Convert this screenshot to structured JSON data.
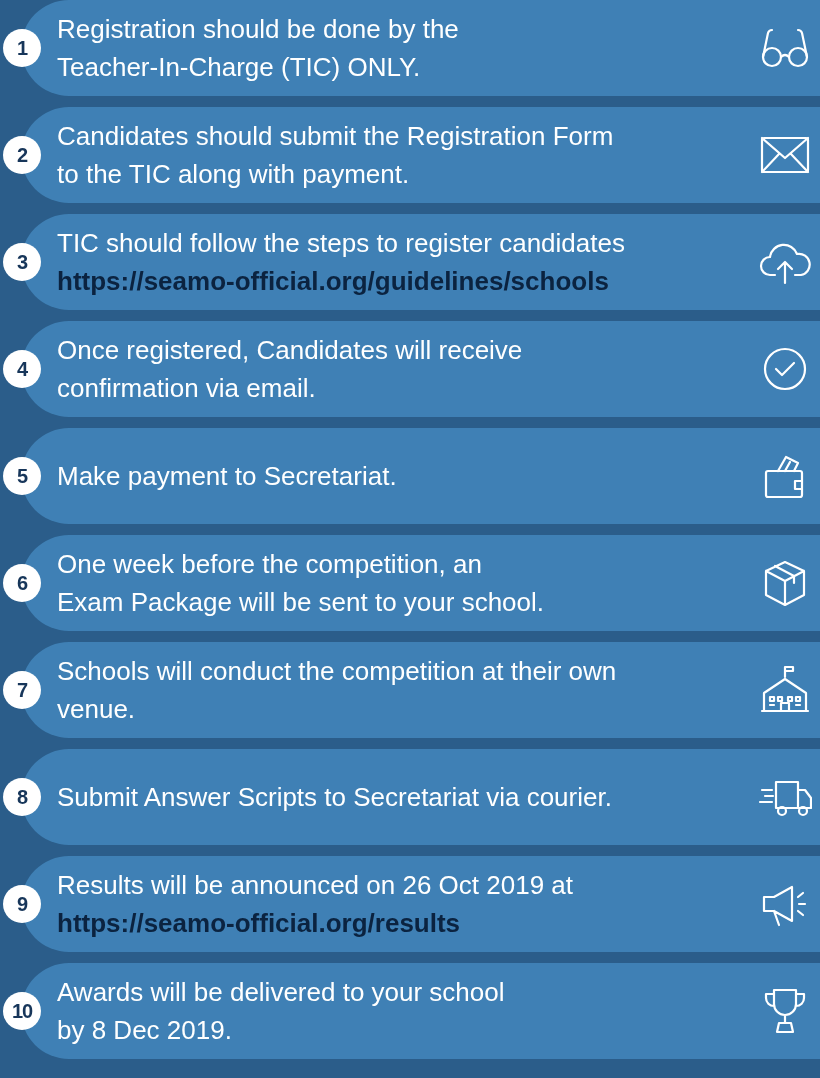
{
  "steps": [
    {
      "number": "1",
      "lines": [
        "Registration should be done by the",
        "Teacher-In-Charge (TIC) ONLY."
      ]
    },
    {
      "number": "2",
      "lines": [
        "Candidates should submit the Registration Form",
        "to the TIC along with payment."
      ]
    },
    {
      "number": "3",
      "lines": [
        "TIC should follow the steps to register candidates"
      ],
      "link": "https://seamo-official.org/guidelines/schools"
    },
    {
      "number": "4",
      "lines": [
        "Once registered, Candidates will receive",
        "confirmation via email."
      ]
    },
    {
      "number": "5",
      "lines": [
        "Make payment to Secretariat."
      ]
    },
    {
      "number": "6",
      "lines": [
        "One week before the competition, an",
        "Exam Package will be sent to your school."
      ]
    },
    {
      "number": "7",
      "lines": [
        "Schools will conduct the competition at their own",
        "venue."
      ]
    },
    {
      "number": "8",
      "lines": [
        "Submit Answer Scripts to Secretariat via courier."
      ]
    },
    {
      "number": "9",
      "lines": [
        "Results will be announced on 26 Oct 2019 at"
      ],
      "link": "https://seamo-official.org/results"
    },
    {
      "number": "10",
      "lines": [
        "Awards will be delivered to your school",
        "by 8 Dec 2019."
      ]
    }
  ]
}
